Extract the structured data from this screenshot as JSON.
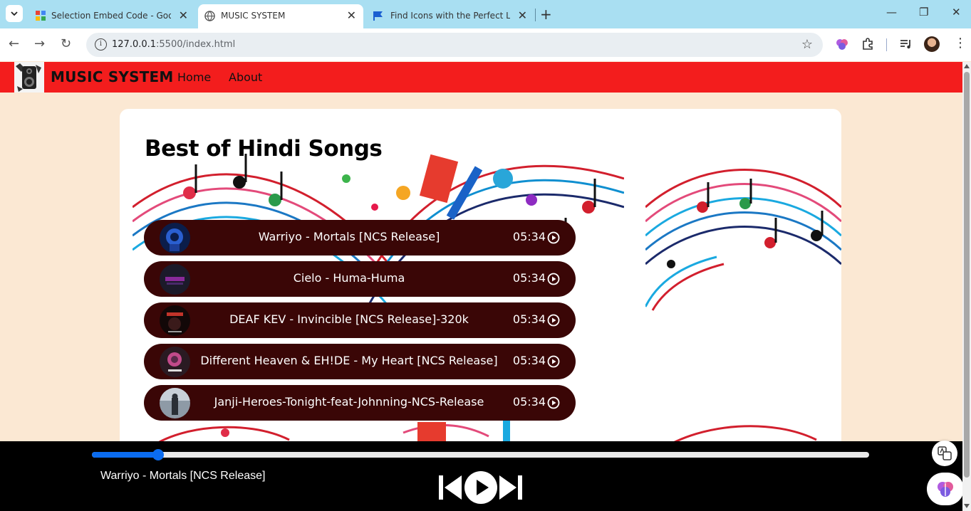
{
  "browser": {
    "tabs": [
      {
        "title": "Selection Embed Code - Google",
        "active": false
      },
      {
        "title": "MUSIC SYSTEM",
        "active": true
      },
      {
        "title": "Find Icons with the Perfect Look",
        "active": false
      }
    ],
    "url_host": "127.0.0.1",
    "url_path": ":5500/index.html"
  },
  "navbar": {
    "brand": "MUSIC SYSTEM",
    "links": [
      "Home",
      "About"
    ],
    "color": "#f31d1d"
  },
  "main": {
    "heading": "Best of Hindi Songs",
    "songs": [
      {
        "title": "Warriyo - Mortals [NCS Release]",
        "duration": "05:34"
      },
      {
        "title": "Cielo - Huma-Huma",
        "duration": "05:34"
      },
      {
        "title": "DEAF KEV - Invincible [NCS Release]-320k",
        "duration": "05:34"
      },
      {
        "title": "Different Heaven & EH!DE - My Heart [NCS Release]",
        "duration": "05:34"
      },
      {
        "title": "Janji-Heroes-Tonight-feat-Johnning-NCS-Release",
        "duration": "05:34"
      }
    ]
  },
  "player": {
    "now_playing": "Warriyo - Mortals [NCS Release]",
    "progress_percent": 8.5,
    "accent": "#0b6cf0"
  }
}
